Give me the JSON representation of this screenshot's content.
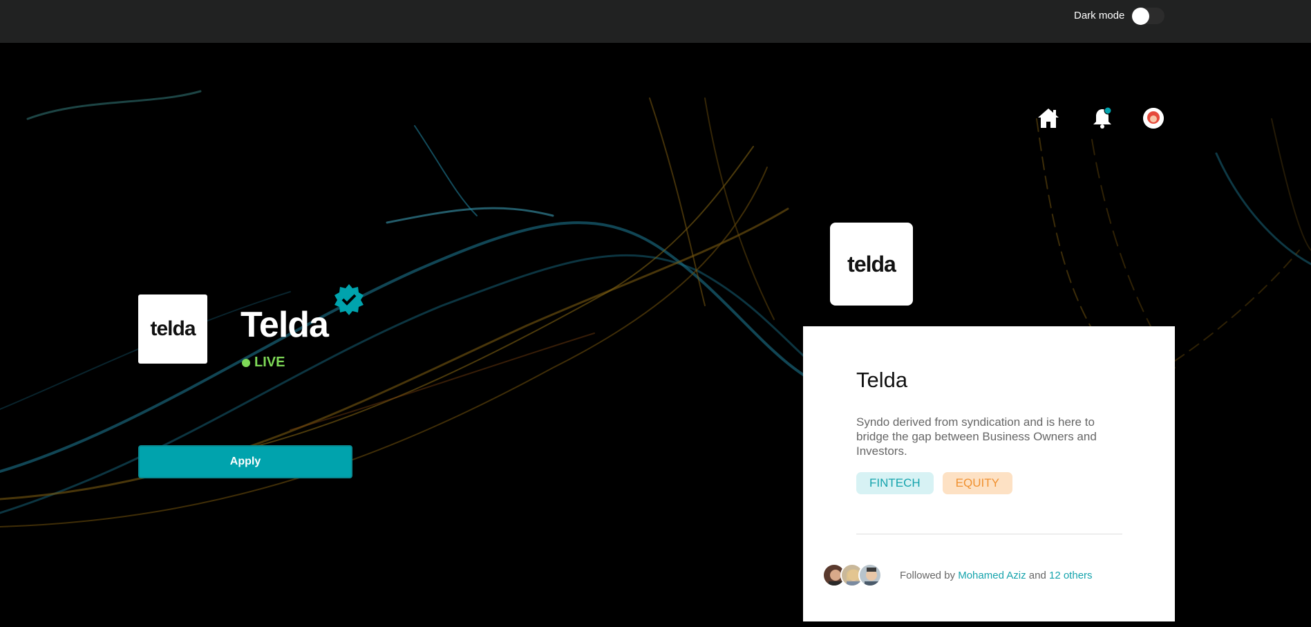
{
  "topbar": {
    "dark_mode_label": "Dark mode",
    "dark_mode_on": false
  },
  "nav": {
    "home_icon": "home-icon",
    "bell_icon": "bell-icon",
    "avatar_icon": "avatar"
  },
  "company": {
    "logo_text": "telda",
    "name": "Telda",
    "status": "LIVE",
    "apply_label": "Apply"
  },
  "card": {
    "logo_text": "telda",
    "title": "Telda",
    "description": "Syndo derived from syndication and is here to bridge the gap between Business Owners and Investors.",
    "tags": [
      "FINTECH",
      "EQUITY"
    ],
    "followed_prefix": "Followed by",
    "followed_name": "Mohamed Aziz",
    "followed_and": "and",
    "followed_others": "12 others"
  },
  "colors": {
    "accent": "#00a3ad",
    "live": "#7ed957",
    "topbar": "#212222"
  }
}
